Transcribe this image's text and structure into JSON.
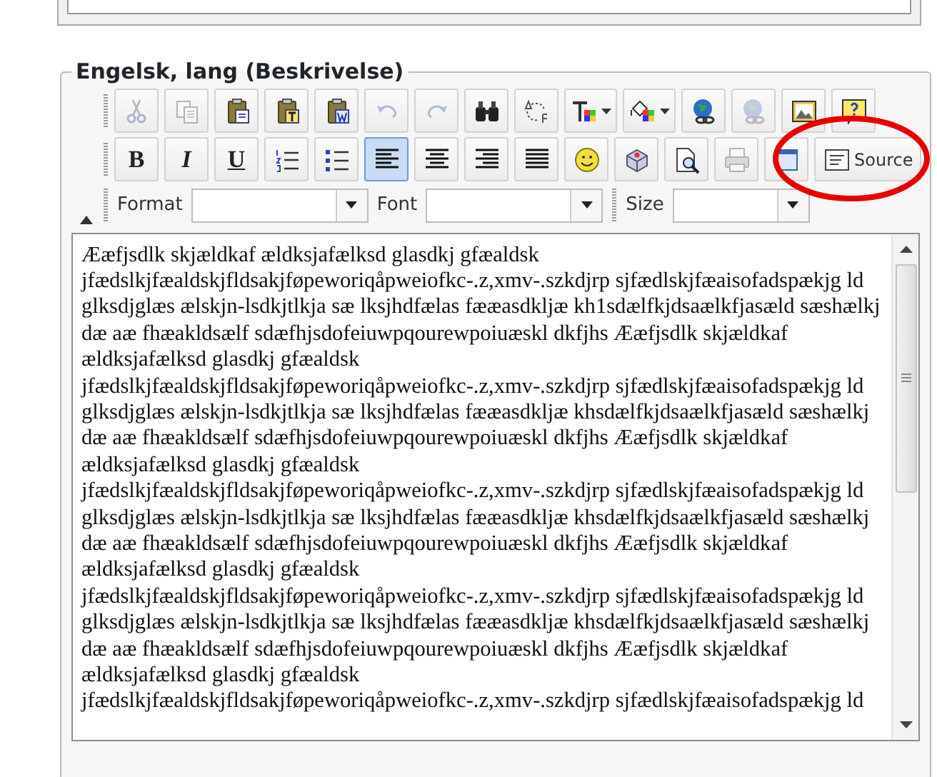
{
  "fieldset": {
    "legend": "Engelsk, lang (Beskrivelse)"
  },
  "toolbar_rows": [
    [
      {
        "kind": "cut",
        "disabled": true,
        "selected": false,
        "dropdown": false
      },
      {
        "kind": "copy",
        "disabled": true,
        "selected": false,
        "dropdown": false
      },
      {
        "kind": "paste",
        "disabled": false,
        "selected": false,
        "dropdown": false
      },
      {
        "kind": "paste-text",
        "disabled": false,
        "selected": false,
        "dropdown": false
      },
      {
        "kind": "paste-word",
        "disabled": false,
        "selected": false,
        "dropdown": false
      },
      {
        "kind": "undo",
        "disabled": true,
        "selected": false,
        "dropdown": false
      },
      {
        "kind": "redo",
        "disabled": true,
        "selected": false,
        "dropdown": false
      },
      {
        "kind": "find",
        "disabled": false,
        "selected": false,
        "dropdown": false
      },
      {
        "kind": "replace",
        "disabled": false,
        "selected": false,
        "dropdown": false
      },
      {
        "kind": "text-color",
        "disabled": false,
        "selected": false,
        "dropdown": true
      },
      {
        "kind": "bg-color",
        "disabled": false,
        "selected": false,
        "dropdown": true
      },
      {
        "kind": "link",
        "disabled": false,
        "selected": false,
        "dropdown": false
      },
      {
        "kind": "unlink",
        "disabled": true,
        "selected": false,
        "dropdown": false
      },
      {
        "kind": "image",
        "disabled": false,
        "selected": false,
        "dropdown": false
      },
      {
        "kind": "help",
        "disabled": false,
        "selected": false,
        "dropdown": false
      }
    ],
    [
      {
        "kind": "bold",
        "label": "B",
        "disabled": false,
        "selected": false,
        "dropdown": false
      },
      {
        "kind": "italic",
        "label": "I",
        "disabled": false,
        "selected": false,
        "dropdown": false
      },
      {
        "kind": "underline",
        "label": "U",
        "disabled": false,
        "selected": false,
        "dropdown": false
      },
      {
        "kind": "ordered-list",
        "disabled": false,
        "selected": false,
        "dropdown": false
      },
      {
        "kind": "bullet-list",
        "disabled": false,
        "selected": false,
        "dropdown": false
      },
      {
        "kind": "align-left",
        "disabled": false,
        "selected": true,
        "dropdown": false
      },
      {
        "kind": "align-center",
        "disabled": false,
        "selected": false,
        "dropdown": false
      },
      {
        "kind": "align-right",
        "disabled": false,
        "selected": false,
        "dropdown": false
      },
      {
        "kind": "justify",
        "disabled": false,
        "selected": false,
        "dropdown": false
      },
      {
        "kind": "smiley",
        "disabled": false,
        "selected": false,
        "dropdown": false
      },
      {
        "kind": "special",
        "disabled": false,
        "selected": false,
        "dropdown": false
      },
      {
        "kind": "preview",
        "disabled": false,
        "selected": false,
        "dropdown": false
      },
      {
        "kind": "print",
        "disabled": true,
        "selected": false,
        "dropdown": false
      },
      {
        "kind": "maximize",
        "disabled": false,
        "selected": false,
        "dropdown": false
      },
      {
        "kind": "source",
        "label": "Source",
        "disabled": false,
        "selected": false,
        "dropdown": false,
        "circled": true
      }
    ]
  ],
  "combos": [
    {
      "label": "Format"
    },
    {
      "label": "Font"
    },
    {
      "label": "Size"
    }
  ],
  "editor": {
    "lines": [
      "Ææfjsdlk skjældkaf ældksjafælksd glasdkj gfæaldsk",
      "jfædslkjfæaldskjfldsakjføpeworiqåpweiofkc-.z,xmv-.szkdjrp sjfædlskjfæaisofadspækjg ld",
      "glksdjglæs ælskjn-lsdkjtlkja sæ lksjhdfælas fææasdkljæ kh1sdælfkjdsaælkfjasæld sæshælkj",
      "dæ aæ fhæakldsælf sdæfhjsdofeiuwpqourewpoiuæskl dkfjhs Ææfjsdlk skjældkaf",
      "ældksjafælksd glasdkj gfæaldsk",
      "jfædslkjfæaldskjfldsakjføpeworiqåpweiofkc-.z,xmv-.szkdjrp sjfædlskjfæaisofadspækjg ld",
      "glksdjglæs ælskjn-lsdkjtlkja sæ lksjhdfælas fææasdkljæ khsdælfkjdsaælkfjasæld sæshælkj",
      "dæ aæ fhæakldsælf sdæfhjsdofeiuwpqourewpoiuæskl dkfjhs Ææfjsdlk skjældkaf",
      "ældksjafælksd glasdkj gfæaldsk",
      "jfædslkjfæaldskjfldsakjføpeworiqåpweiofkc-.z,xmv-.szkdjrp sjfædlskjfæaisofadspækjg ld",
      "glksdjglæs ælskjn-lsdkjtlkja sæ lksjhdfælas fææasdkljæ khsdælfkjdsaælkfjasæld sæshælkj",
      "dæ aæ fhæakldsælf sdæfhjsdofeiuwpqourewpoiuæskl dkfjhs Ææfjsdlk skjældkaf",
      "ældksjafælksd glasdkj gfæaldsk",
      "jfædslkjfæaldskjfldsakjføpeworiqåpweiofkc-.z,xmv-.szkdjrp sjfædlskjfæaisofadspækjg ld",
      "glksdjglæs ælskjn-lsdkjtlkja sæ lksjhdfælas fææasdkljæ khsdælfkjdsaælkfjasæld sæshælkj",
      "dæ aæ fhæakldsælf sdæfhjsdofeiuwpqourewpoiuæskl dkfjhs Ææfjsdlk skjældkaf",
      "ældksjafælksd glasdkj gfæaldsk",
      "jfædslkjfæaldskjfldsakjføpeworiqåpweiofkc-.z,xmv-.szkdjrp sjfædlskjfæaisofadspækjg ld"
    ]
  }
}
